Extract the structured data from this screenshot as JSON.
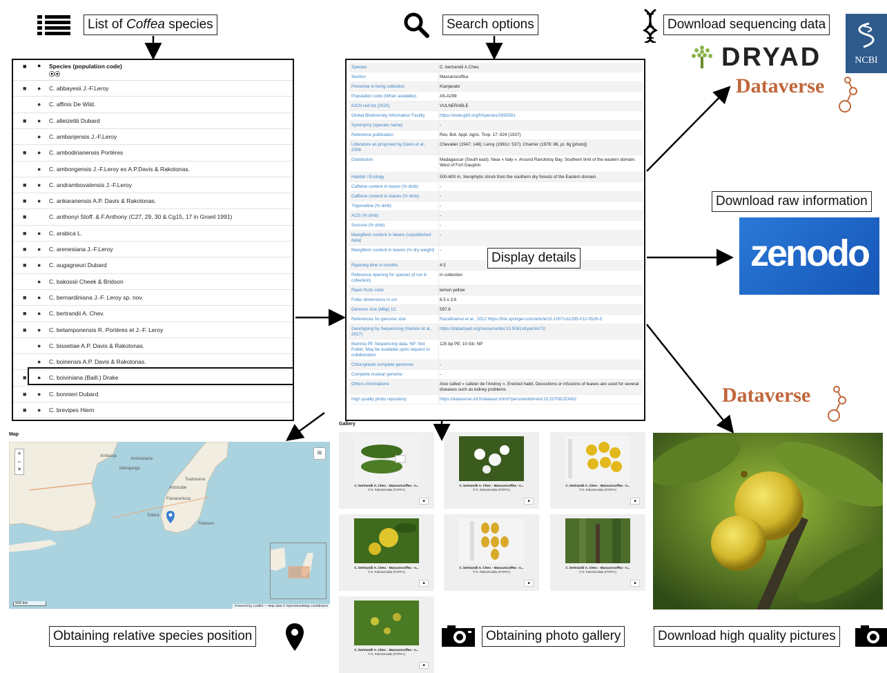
{
  "callouts": {
    "list_pre": "List of ",
    "list_em": "Coffea",
    "list_post": " species",
    "search": "Search options",
    "sequencing": "Download sequencing data",
    "raw": "Download raw information",
    "details": "Display details",
    "position": "Obtaining relative species position",
    "gallery": "Obtaining photo gallery",
    "pictures": "Download high quality pictures"
  },
  "logos": {
    "dryad": "DRYAD",
    "ncbi": "NCBI",
    "dataverse": "Dataverse",
    "zenodo": "zenodo"
  },
  "species_list": {
    "header": "Species (population code)",
    "rows": [
      {
        "name": "C. abbayesii J.-F.Leroy",
        "camera": true
      },
      {
        "name": "C. affinis De Wild.",
        "camera": false
      },
      {
        "name": "C. alleizettii Dubard",
        "camera": true
      },
      {
        "name": "C. ambanjensis J.-F.Leroy",
        "camera": false
      },
      {
        "name": "C. ambodirianensis Portères",
        "camera": true
      },
      {
        "name": "C. ambongensis J.-F.Leroy ex A.P.Davis & Rakotonas.",
        "camera": false
      },
      {
        "name": "C. andrambovatensis J.-F.Leroy",
        "camera": true
      },
      {
        "name": "C. ankaranensis A.P. Davis & Rakotonas.",
        "camera": true
      },
      {
        "name": "C. anthonyi Stoff. & F.Anthony (C27, 29, 30 & Cg15, 17 in Groeil 1991)",
        "camera": true,
        "nopin": true
      },
      {
        "name": "C. arabica L.",
        "camera": true
      },
      {
        "name": "C. arenesiana J.-F.Leroy",
        "camera": true
      },
      {
        "name": "C. augagneuri Dubard",
        "camera": true
      },
      {
        "name": "C. bakossii Cheek & Bridson",
        "camera": false
      },
      {
        "name": "C. bernardiniana J.-F. Leroy sp. nov.",
        "camera": true
      },
      {
        "name": "C. bertrandii A. Chev.",
        "camera": true
      },
      {
        "name": "C. betamponensis R. Portères et J.-F. Leroy",
        "camera": true
      },
      {
        "name": "C. bissetiae A.P. Davis & Rakotonas.",
        "camera": false
      },
      {
        "name": "C. boinensis A.P. Davis & Rakotonas.",
        "camera": false
      },
      {
        "name": "C. boiviniana (Baill.) Drake",
        "camera": true
      },
      {
        "name": "C. bonnieri Dubard",
        "camera": true
      },
      {
        "name": "C. brevipes Hiern",
        "camera": true
      }
    ]
  },
  "details": {
    "rows": [
      {
        "k": "Species",
        "v": "C. bertrandii A.Chev.",
        "h": 14
      },
      {
        "k": "Section",
        "v": "Mascarocoffea",
        "h": 14
      },
      {
        "k": "Presence in living collection",
        "v": "Kianjavato",
        "h": 14
      },
      {
        "k": "Population code (When available)",
        "v": "A5-A299",
        "h": 14
      },
      {
        "k": "IUCN red list (2020)",
        "v": "VULNERABLE",
        "h": 14
      },
      {
        "k": "Global Biodiversity Information Facility",
        "v": "https://www.gbif.org/fr/species/2935561",
        "h": 14,
        "link": true
      },
      {
        "k": "Synonymy (species name)",
        "v": "-",
        "h": 14
      },
      {
        "k": "Reference publication",
        "v": "Rev. Bot. Appl. Agric. Trop. 17: 824 (1937)",
        "h": 14
      },
      {
        "k": "Litterature as proposed by Davis et al., 2006",
        "v": "Chevalier (1947: 148); Leroy (1961c: 537); Charrier (1978: 86, pl. 8g [photo])",
        "h": 22
      },
      {
        "k": "Distribution",
        "v": "Madagascar (South east). Near « Italy ». Around Ranofotsy Bay. Southern limit of the eastern domain. West of Fort Dauphin",
        "h": 25
      },
      {
        "k": "Habitat / Ecology",
        "v": "500-600 m. Xerophytic shrub from the southern dry forests of the Eastern domain",
        "h": 14
      },
      {
        "k": "Caffeine content in beans (% dmb)",
        "v": "-",
        "h": 14
      },
      {
        "k": "Caffeine content in leaves (% dmb)",
        "v": "-",
        "h": 14
      },
      {
        "k": "Trigonelline (% dmb)",
        "v": "-",
        "h": 14
      },
      {
        "k": "ACG (% dmb)",
        "v": "-",
        "h": 14
      },
      {
        "k": "Sucrose (% dmb)",
        "v": "-",
        "h": 14
      },
      {
        "k": "Mangiferin content in beans (unpublished data)",
        "v": "-",
        "h": 22
      },
      {
        "k": "Mangiferin content in leaves (% dry weight)",
        "v": "-",
        "h": 22
      },
      {
        "k": "Ripening time in months",
        "v": "4.5",
        "h": 14
      },
      {
        "k": "Reference ripening for species (if not in collection)",
        "v": "in collection",
        "h": 22
      },
      {
        "k": "Ripen fruits color",
        "v": "lemon yellow",
        "h": 14
      },
      {
        "k": "Foliar dimensions in cm",
        "v": "6.5 x 3.6",
        "h": 14
      },
      {
        "k": "Genome size (Mbp) 1C",
        "v": "597.8",
        "h": 14
      },
      {
        "k": "References for genome size",
        "v": "Razafinarivo et al., 2012 https://link.springer.com/article/10.1007/s11295-012-0526-5",
        "h": 14,
        "link": true
      },
      {
        "k": "Genotyping by Sequencing (Hamon et al., 2017)",
        "v": "https://datadryad.org/resource/doi:10.5061/dryad.kk71t",
        "h": 22,
        "link": true
      },
      {
        "k": "Illumina PE Sequencing data. NP: Not Public; May be available upon request or collaboration",
        "v": "125 bp PE; 10 Gb; NP",
        "h": 30
      },
      {
        "k": "Chloroplaste complete genomes",
        "v": "-",
        "h": 14
      },
      {
        "k": "Complete nuclear genome",
        "v": "-",
        "h": 14
      },
      {
        "k": "Others informations",
        "v": "Also called « cafeier de l'Androy ». Erected habit. Decoctions or infusions of leaves are used for several diseases such as kidney problems",
        "h": 22
      },
      {
        "k": "High quality photo repository",
        "v": "https://dataverse.ird.fr/dataset.xhtml?persistentId=doi:10.23708/JZA8I2",
        "h": 14,
        "link": true
      }
    ]
  },
  "map": {
    "title": "Map",
    "scale": "500 km",
    "attribution": "Powered by Leaflet — Map data © OpenStreetMap contributors",
    "labels": [
      "Ambanja",
      "Antsiranana",
      "Mahajanga",
      "Toamasina",
      "Antsirabe",
      "Fianarantsoa",
      "Toliara",
      "Tolanaro"
    ]
  },
  "gallery": {
    "title": "Gallery",
    "caption": "C. bertrandii A. Chev. - Mascarocoffea - n...",
    "credit": "© N. Rakotomalala (FOFIFA)"
  },
  "colors": {
    "link": "#3b82c4",
    "zenodo_bg": "#1f67c7",
    "ncbi_bg": "#2e5a8c",
    "dataverse": "#c0663a",
    "dryad_text": "#222222",
    "map_water": "#aad3df",
    "map_land": "#f1ede1"
  }
}
